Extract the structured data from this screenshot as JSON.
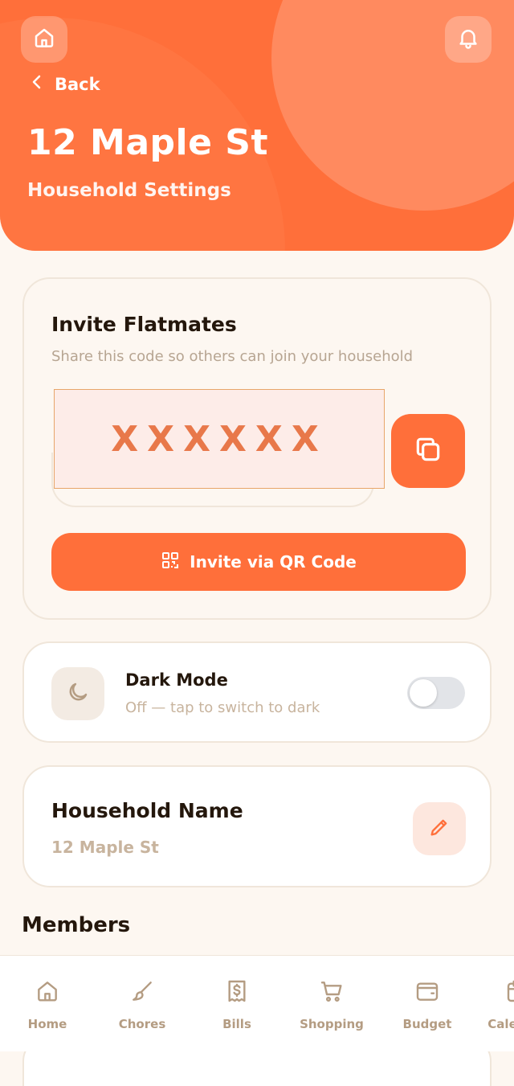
{
  "header": {
    "back_label": "Back",
    "title": "12 Maple St",
    "subtitle": "Household Settings",
    "home_icon": "home-icon",
    "bell_icon": "bell-icon"
  },
  "invite": {
    "title": "Invite Flatmates",
    "subtitle": "Share this code so others can join your household",
    "code": "XXXXXX",
    "copy_icon": "copy-icon",
    "qr_label": "Invite via QR Code",
    "qr_icon": "qr-code-icon"
  },
  "dark_mode": {
    "title": "Dark Mode",
    "status": "Off — tap to switch to dark",
    "enabled": false,
    "icon": "moon-icon"
  },
  "household_name": {
    "title": "Household Name",
    "value": "12 Maple St",
    "edit_icon": "pencil-icon"
  },
  "members": {
    "title": "Members"
  },
  "nav": {
    "items": [
      {
        "label": "Home",
        "icon": "home-icon"
      },
      {
        "label": "Chores",
        "icon": "brush-icon"
      },
      {
        "label": "Bills",
        "icon": "receipt-icon"
      },
      {
        "label": "Shopping",
        "icon": "cart-icon"
      },
      {
        "label": "Budget",
        "icon": "wallet-icon"
      },
      {
        "label": "Calendar",
        "icon": "calendar-icon"
      }
    ]
  },
  "colors": {
    "accent": "#ff6f3a",
    "background": "#fdf7f1",
    "muted_text": "#c8b49e"
  }
}
